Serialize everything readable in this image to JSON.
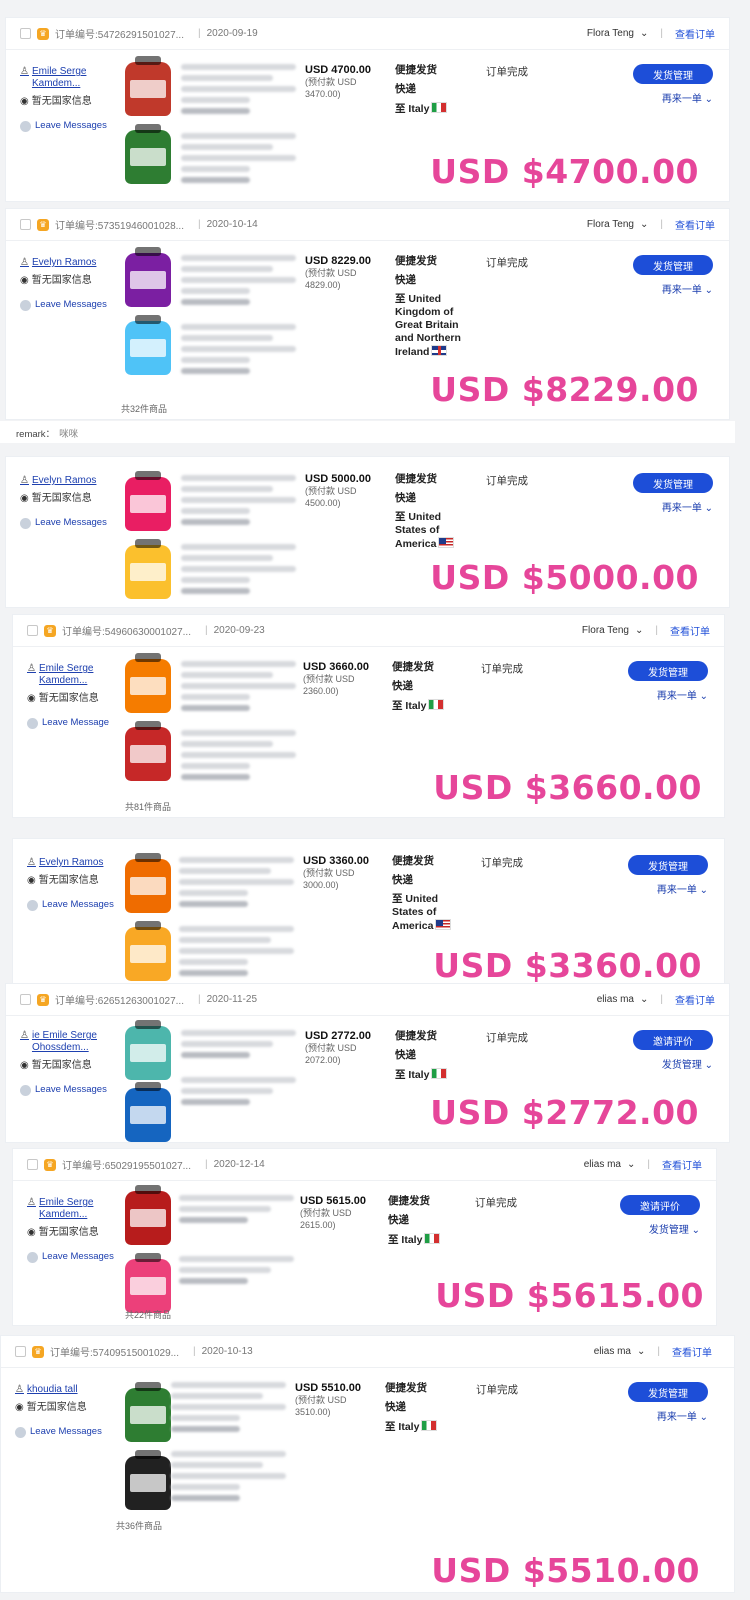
{
  "orders": [
    {
      "header": {
        "order_no": "订单编号:54726291501027...",
        "date": "2020-09-19",
        "staff": "Flora Teng",
        "view": "查看订单"
      },
      "buyer": {
        "name": "Emile Serge Kamdem...",
        "country": "暂无国家信息",
        "leave": "Leave Messages"
      },
      "price": {
        "amount": "USD 4700.00",
        "prepaid_label": "(预付款 USD",
        "prepaid": "3470.00)"
      },
      "ship": {
        "method": "便捷发货",
        "speed": "快递",
        "dest": "至 Italy"
      },
      "status": "订单完成",
      "button": "发货管理",
      "sub": "再来一单 ⌄",
      "total": "USD $4700.00",
      "count": "",
      "colors": [
        "#c0392b",
        "#2e7d32"
      ]
    },
    {
      "header": {
        "order_no": "订单编号:57351946001028...",
        "date": "2020-10-14",
        "staff": "Flora Teng",
        "view": "查看订单"
      },
      "buyer": {
        "name": "Evelyn Ramos",
        "country": "暂无国家信息",
        "leave": "Leave Messages"
      },
      "price": {
        "amount": "USD 8229.00",
        "prepaid_label": "(预付款 USD",
        "prepaid": "4829.00)"
      },
      "ship": {
        "method": "便捷发货",
        "speed": "快递",
        "dest": "至 United Kingdom of Great Britain and Northern Ireland"
      },
      "status": "订单完成",
      "button": "发货管理",
      "sub": "再来一单 ⌄",
      "total": "USD $8229.00",
      "count": "共32件商品",
      "colors": [
        "#7b1fa2",
        "#4fc3f7"
      ]
    },
    {
      "header": null,
      "buyer": {
        "name": "Evelyn Ramos",
        "country": "暂无国家信息",
        "leave": "Leave Messages"
      },
      "price": {
        "amount": "USD 5000.00",
        "prepaid_label": "(预付款 USD",
        "prepaid": "4500.00)"
      },
      "ship": {
        "method": "便捷发货",
        "speed": "快递",
        "dest": "至 United States of America"
      },
      "status": "订单完成",
      "button": "发货管理",
      "sub": "再来一单 ⌄",
      "total": "USD $5000.00",
      "count": "",
      "colors": [
        "#e91e63",
        "#fbc02d"
      ]
    },
    {
      "header": {
        "order_no": "订单编号:54960630001027...",
        "date": "2020-09-23",
        "staff": "Flora Teng",
        "view": "查看订单"
      },
      "buyer": {
        "name": "Emile Serge Kamdem...",
        "country": "暂无国家信息",
        "leave": "Leave Message"
      },
      "price": {
        "amount": "USD 3660.00",
        "prepaid_label": "(预付款 USD",
        "prepaid": "2360.00)"
      },
      "ship": {
        "method": "便捷发货",
        "speed": "快递",
        "dest": "至 Italy"
      },
      "status": "订单完成",
      "button": "发货管理",
      "sub": "再来一单 ⌄",
      "total": "USD $3660.00",
      "count": "共81件商品",
      "colors": [
        "#f57c00",
        "#c62828"
      ]
    },
    {
      "header": null,
      "buyer": {
        "name": "Evelyn Ramos",
        "country": "暂无国家信息",
        "leave": "Leave Messages"
      },
      "price": {
        "amount": "USD 3360.00",
        "prepaid_label": "(预付款 USD",
        "prepaid": "3000.00)"
      },
      "ship": {
        "method": "便捷发货",
        "speed": "快递",
        "dest": "至 United States of America"
      },
      "status": "订单完成",
      "button": "发货管理",
      "sub": "再来一单 ⌄",
      "total": "USD $3360.00",
      "count": "",
      "colors": [
        "#ef6c00",
        "#f9a825"
      ]
    },
    {
      "header": {
        "order_no": "订单编号:62651263001027...",
        "date": "2020-11-25",
        "staff": "elias ma",
        "view": "查看订单"
      },
      "buyer": {
        "name": "ie Emile Serge Ohossdem...",
        "country": "暂无国家信息",
        "leave": "Leave Messages"
      },
      "price": {
        "amount": "USD 2772.00",
        "prepaid_label": "(预付款 USD",
        "prepaid": "2072.00)"
      },
      "ship": {
        "method": "便捷发货",
        "speed": "快递",
        "dest": "至 Italy"
      },
      "status": "订单完成",
      "button": "邀请评价",
      "sub": "发货管理 ⌄",
      "total": "USD $2772.00",
      "count": "",
      "colors": [
        "#4db6ac",
        "#1565c0"
      ]
    },
    {
      "header": {
        "order_no": "订单编号:65029195501027...",
        "date": "2020-12-14",
        "staff": "elias ma",
        "view": "查看订单"
      },
      "buyer": {
        "name": "Emile Serge Kamdem...",
        "country": "暂无国家信息",
        "leave": "Leave Messages"
      },
      "price": {
        "amount": "USD 5615.00",
        "prepaid_label": "(预付款 USD",
        "prepaid": "2615.00)"
      },
      "ship": {
        "method": "便捷发货",
        "speed": "快递",
        "dest": "至 Italy"
      },
      "status": "订单完成",
      "button": "邀请评价",
      "sub": "发货管理 ⌄",
      "total": "USD $5615.00",
      "count": "共22件商品",
      "colors": [
        "#b71c1c",
        "#ec407a"
      ]
    },
    {
      "header": {
        "order_no": "订单编号:57409515001029...",
        "date": "2020-10-13",
        "staff": "elias ma",
        "view": "查看订单"
      },
      "buyer": {
        "name": "khoudia tall",
        "country": "暂无国家信息",
        "leave": "Leave Messages"
      },
      "price": {
        "amount": "USD 5510.00",
        "prepaid_label": "(预付款 USD",
        "prepaid": "3510.00)"
      },
      "ship": {
        "method": "便捷发货",
        "speed": "快递",
        "dest": "至 Italy"
      },
      "status": "订单完成",
      "button": "发货管理",
      "sub": "再来一单 ⌄",
      "total": "USD $5510.00",
      "count": "共36件商品",
      "colors": [
        "#2e7d32",
        "#212121"
      ]
    }
  ],
  "remark": {
    "label": "remark：",
    "value": "咪咪"
  }
}
